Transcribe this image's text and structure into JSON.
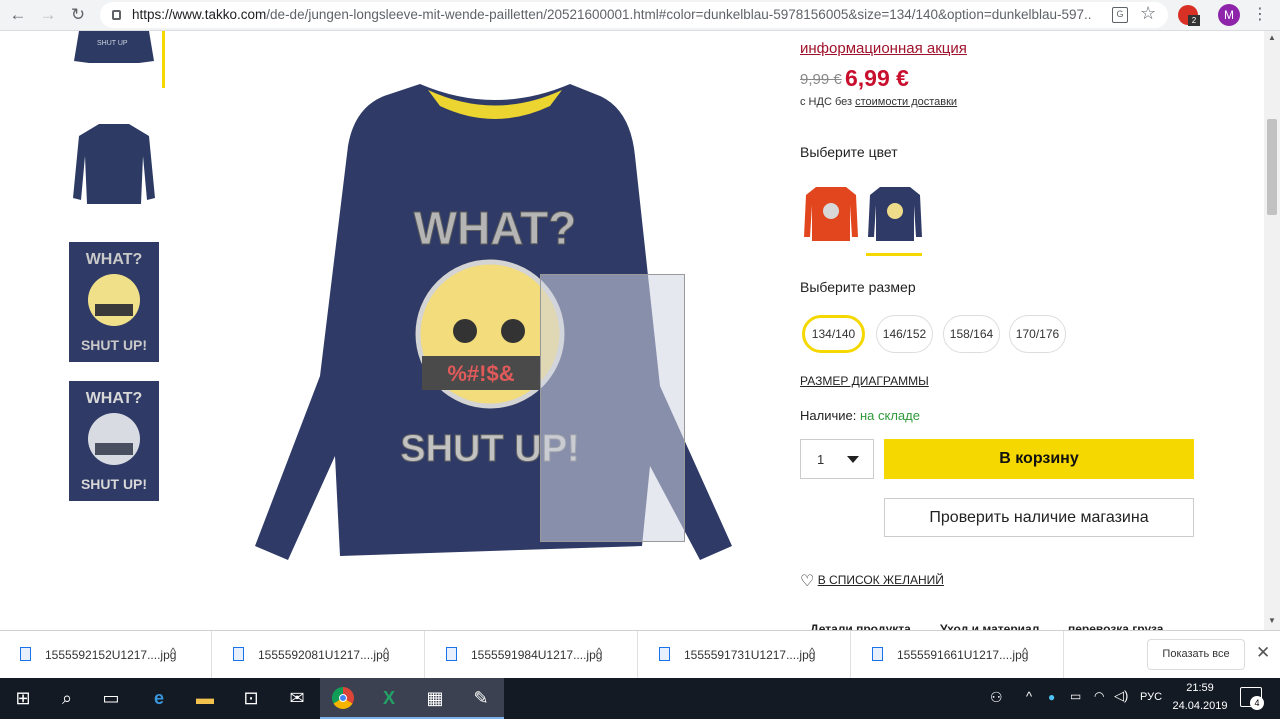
{
  "browser": {
    "url_host": "https://www.takko.com",
    "url_path": "/de-de/jungen-longsleeve-mit-wende-pailletten/20521600001.html#color=dunkelblau-5978156005&size=134/140&option=dunkelblau-597...",
    "profile_initial": "M",
    "extension_badge": "2"
  },
  "product": {
    "promo_link": "информационная акция",
    "old_price": "9,99 €",
    "price": "6,99 €",
    "vat_prefix": "с НДС без",
    "shipping_link": "стоимости доставки",
    "color_label": "Выберите цвет",
    "size_label": "Выберите размер",
    "sizes": [
      "134/140",
      "146/152",
      "158/164",
      "170/176"
    ],
    "selected_size": "134/140",
    "size_chart_link": "РАЗМЕР ДИАГРАММЫ",
    "availability_label": "Наличие:",
    "availability_value": "на складе",
    "quantity": "1",
    "add_to_cart": "В корзину",
    "check_store": "Проверить наличие магазина",
    "wishlist": "В СПИСОК ЖЕЛАНИЙ",
    "tabs_partial": [
      "Детали продукта",
      "Уход и материал",
      "перевозка груза"
    ],
    "print_top": "WHAT?",
    "print_bottom": "SHUT UP!",
    "print_mouth": "%#!$&",
    "brand_color": "#f5d800",
    "price_color": "#c8102e"
  },
  "thumbnails": [
    {
      "label": "SHUT UP"
    },
    {
      "label": ""
    },
    {
      "top": "WHAT?",
      "bottom": "SHUT UP!"
    },
    {
      "top": "WHAT?",
      "bottom": "SHUT UP!"
    }
  ],
  "downloads": {
    "items": [
      "1555592152U1217....jpg",
      "1555592081U1217....jpg",
      "1555591984U1217....jpg",
      "1555591731U1217....jpg",
      "1555591661U1217....jpg"
    ],
    "show_all": "Показать все"
  },
  "taskbar": {
    "lang": "РУС",
    "time": "21:59",
    "date": "24.04.2019",
    "notifications": "4"
  }
}
